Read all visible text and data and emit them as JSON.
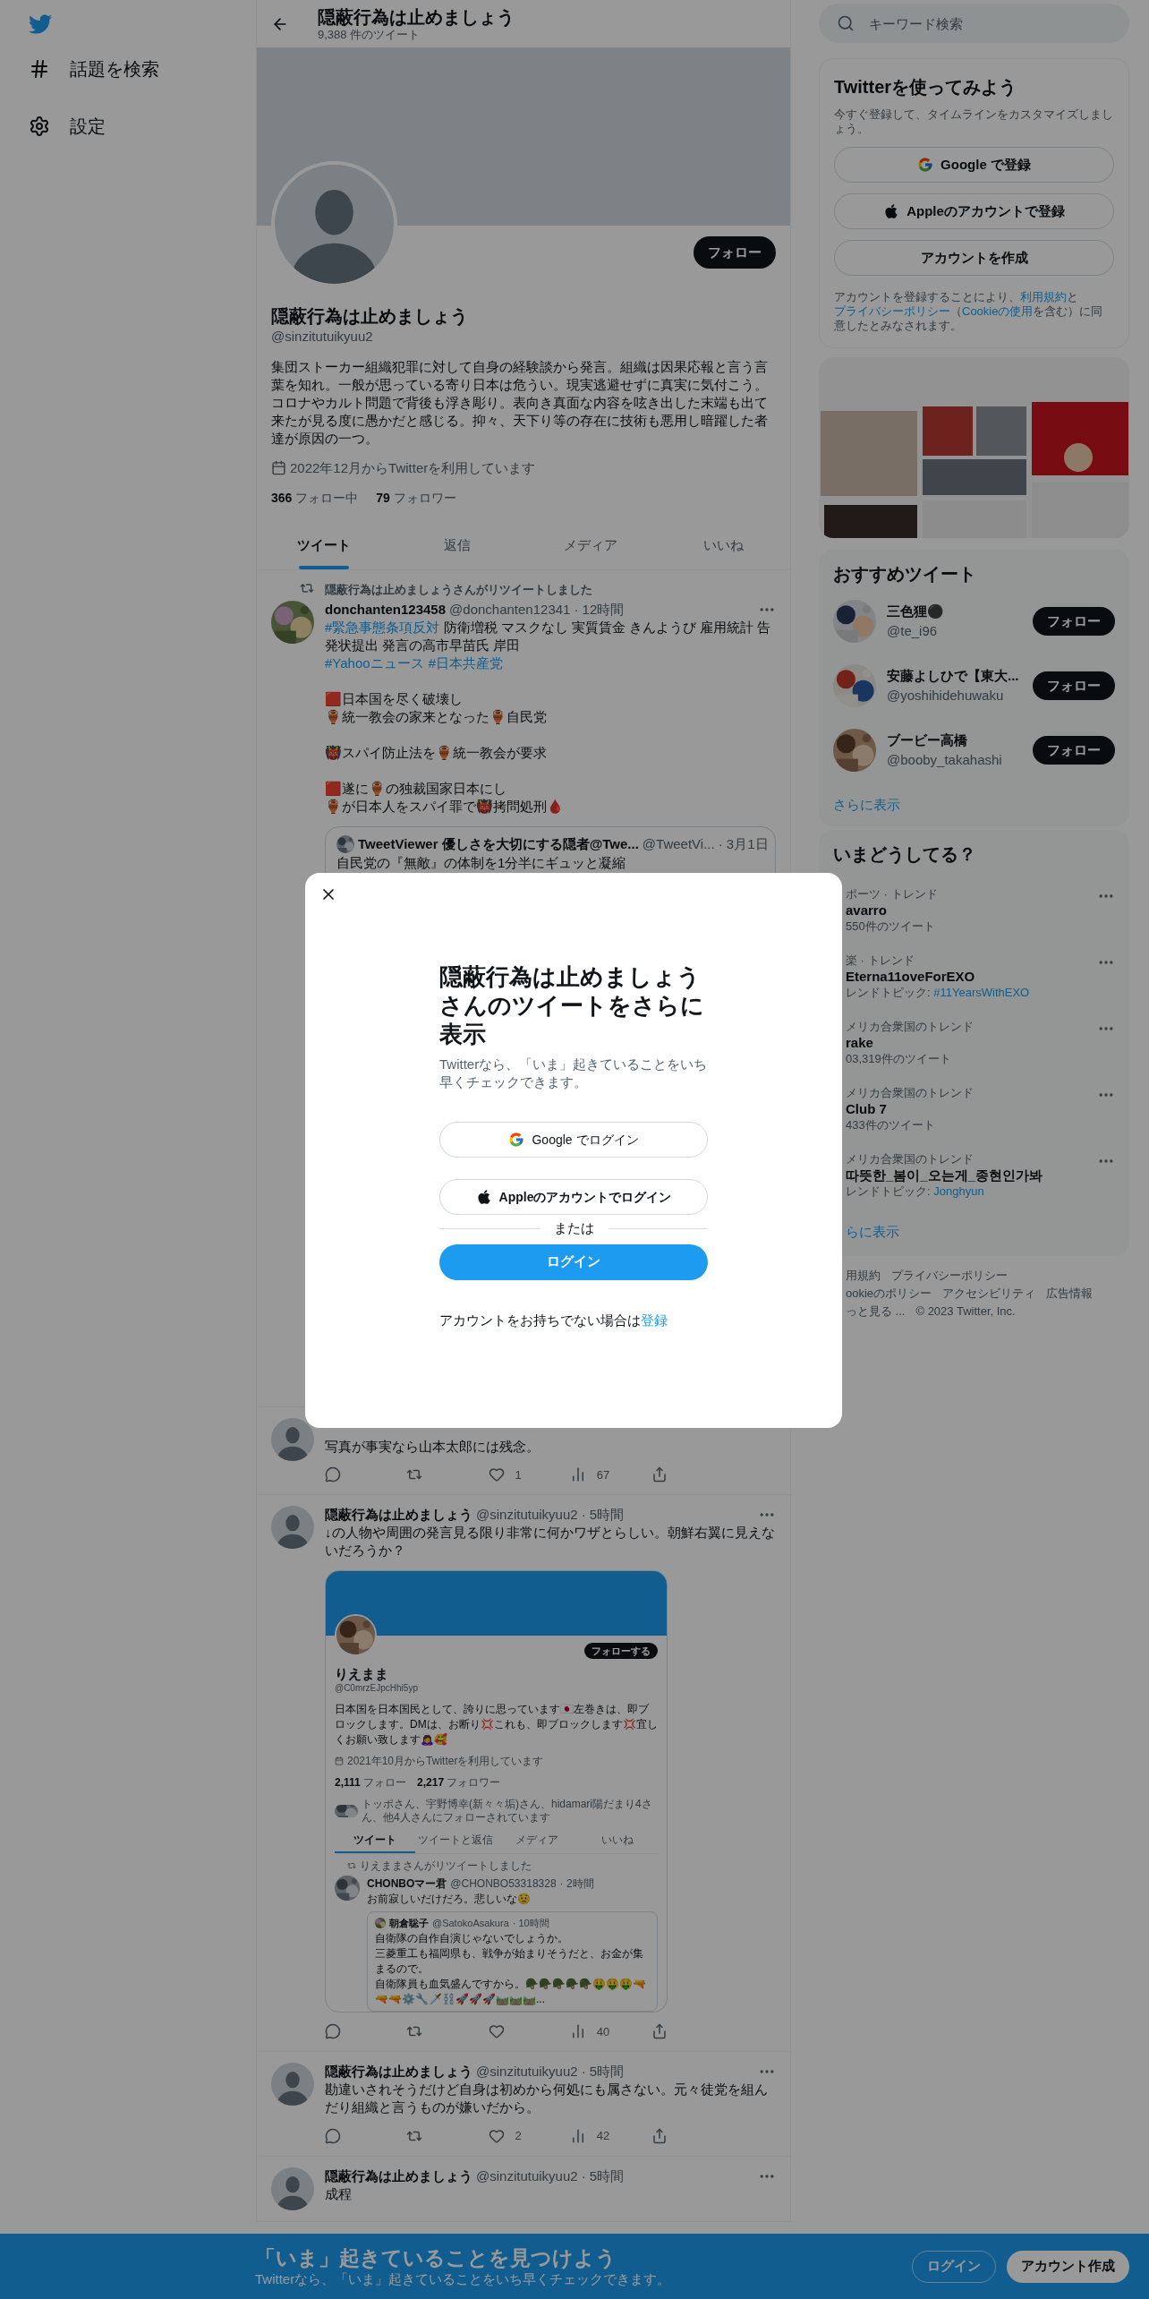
{
  "sidebar": {
    "items": [
      {
        "label": "話題を検索",
        "kind": "hashtag"
      },
      {
        "label": "設定",
        "kind": "settings"
      }
    ]
  },
  "header": {
    "title": "隠蔽行為は止めましょう",
    "subtitle": "9,388 件のツイート"
  },
  "profile": {
    "avatar": {
      "kind": "default"
    },
    "follow_button": "フォロー",
    "name": "隠蔽行為は止めましょう",
    "handle": "@sinzitutuikyuu2",
    "bio": "集団ストーカー組織犯罪に対して自身の経験談から発言。組織は因果応報と言う言葉を知れ。一般が思っている寄り日本は危うい。現実逃避せずに真実に気付こう。コロナやカルト問題で背後も浮き彫り。表向き真面な内容を呟き出した末端も出て来たが見る度に愚かだと感じる。抑々、天下り等の存在に技術も悪用し暗躍した者達が原因の一つ。",
    "joined": "2022年12月からTwitterを利用しています",
    "stats": [
      {
        "count": "366",
        "label": "フォロー中"
      },
      {
        "count": "79",
        "label": "フォロワー"
      }
    ]
  },
  "tabs": [
    {
      "label": "ツイート",
      "selected": true
    },
    {
      "label": "返信",
      "selected": false
    },
    {
      "label": "メディア",
      "selected": false
    },
    {
      "label": "いいね",
      "selected": false
    }
  ],
  "tweets": [
    {
      "retweet_note": "隠蔽行為は止めましょうさんがリツイートしました",
      "avatar": {
        "kind": "picture"
      },
      "name": "donchanten123458",
      "handle": "@donchanten12341",
      "time": "· 12時間",
      "paragraphs": [
        [
          [
            {
              "text": "#緊急事態条項反対",
              "kind": "tag"
            },
            {
              "text": " 防衛増税 マスクなし 実質賃金 きんようび 雇用統計 告発状提出 発言の高市早苗氏 岸田"
            }
          ],
          [
            {
              "text": "#Yahooニュース",
              "kind": "tag"
            },
            {
              "text": "#日本共産党",
              "kind": "tag"
            }
          ]
        ],
        [
          [
            {
              "text": "🟥日本国を尽く破壊し"
            }
          ],
          [
            {
              "text": "🏺統一教会の家来となった🏺自民党"
            }
          ]
        ],
        [
          [
            {
              "text": "👹スパイ防止法を🏺統一教会が要求"
            }
          ]
        ],
        [
          [
            {
              "text": "🟥遂に🏺の独裁国家日本にし"
            }
          ],
          [
            {
              "text": "🏺が日本人をスパイ罪で👹拷問処刑🩸"
            }
          ]
        ]
      ],
      "quote": {
        "avatar": {
          "kind": "picture"
        },
        "name": "TweetViewer 優しさを大切にする隠者@Twe...",
        "handle": "@TweetVi...",
        "time": "· 3月1日",
        "text": "自民党の『無敵』の体制を1分半にギュッと凝縮"
      }
    },
    {
      "avatar": {
        "kind": "default"
      },
      "paragraphs": [
        [
          [
            {
              "text": "写真が事実なら山本太郎には残念。"
            }
          ]
        ]
      ],
      "actions": [
        {
          "kind": "reply"
        },
        {
          "kind": "retweet"
        },
        {
          "kind": "like",
          "count": "1"
        },
        {
          "kind": "views",
          "count": "67"
        },
        {
          "kind": "share"
        }
      ]
    },
    {
      "avatar": {
        "kind": "default"
      },
      "name": "隠蔽行為は止めましょう",
      "handle": "@sinzitutuikyuu2",
      "time": "· 5時間",
      "paragraphs": [
        [
          [
            {
              "text": "↓の人物や周囲の発言見る限り非常に何かワザとらしい。朝鮮右翼に見えないだろうか？"
            }
          ]
        ]
      ],
      "embed": {
        "follow_button": "フォローする",
        "name": "りえまま",
        "handle": "@C0mrzEJpcHhi5yp",
        "bio": "日本国を日本国民として、誇りに思っています🇯🇵左巻きは、即ブロックします。DMは、お断り💢これも、即ブロックします💢宜しくお願い致します🙇‍♀️🥰",
        "joined": "2021年10月からTwitterを利用しています",
        "stats": [
          {
            "count": "2,111",
            "label": "フォロー"
          },
          {
            "count": "2,217",
            "label": "フォロワー"
          }
        ],
        "followed_by": "トッポさん、宇野博幸(新々々垢)さん、hidamari陽だまり4さん、他4人さんにフォローされています",
        "tabs": [
          {
            "label": "ツイート",
            "selected": true
          },
          {
            "label": "ツイートと返信",
            "selected": false
          },
          {
            "label": "メディア",
            "selected": false
          },
          {
            "label": "いいね",
            "selected": false
          }
        ],
        "retweet_note": "りえままさんがリツイートしました",
        "tweet": {
          "name": "CHONBOマー君",
          "handle": "@CHONBO53318328",
          "time": "· 2時間",
          "text": "お前寂しいだけだろ。悲しいな😟"
        },
        "quote": {
          "name": "朝倉聡子",
          "handle": "@SatokoAsakura",
          "time": "· 10時間",
          "lines": [
            "自衛隊の自作自演じゃないでしょうか。",
            "三菱重工も福岡県も、戦争が始まりそうだと、お金が集まるので。",
            "自衛隊員も血気盛んですから。🪖🪖🪖🪖🪖🤑🤑🤑🔫🔫🔫⚙️🔧🗡️⛓️🚀🚀🚀🛤️🛤️🛤️..."
          ]
        }
      },
      "actions": [
        {
          "kind": "reply"
        },
        {
          "kind": "retweet"
        },
        {
          "kind": "like"
        },
        {
          "kind": "views",
          "count": "40"
        },
        {
          "kind": "share"
        }
      ]
    },
    {
      "avatar": {
        "kind": "default"
      },
      "name": "隠蔽行為は止めましょう",
      "handle": "@sinzitutuikyuu2",
      "time": "· 5時間",
      "paragraphs": [
        [
          [
            {
              "text": "勘違いされそうだけど自身は初めから何処にも属さない。元々徒党を組んだり組織と言うものが嫌いだから。"
            }
          ]
        ]
      ],
      "actions": [
        {
          "kind": "reply"
        },
        {
          "kind": "retweet"
        },
        {
          "kind": "like",
          "count": "2"
        },
        {
          "kind": "views",
          "count": "42"
        },
        {
          "kind": "share"
        }
      ]
    },
    {
      "avatar": {
        "kind": "default"
      },
      "name": "隠蔽行為は止めましょう",
      "handle": "@sinzitutuikyuu2",
      "time": "· 5時間",
      "paragraphs": [
        [
          [
            {
              "text": "成程"
            }
          ]
        ]
      ]
    }
  ],
  "search": {
    "placeholder": "キーワード検索"
  },
  "signup": {
    "title": "Twitterを使ってみよう",
    "text": "今すぐ登録して、タイムラインをカスタマイズしましょう。",
    "buttons": [
      {
        "label": "Google で登録",
        "kind": "google"
      },
      {
        "label": "Appleのアカウントで登録",
        "kind": "apple"
      },
      {
        "label": "アカウントを作成",
        "kind": "plain"
      }
    ],
    "legal": [
      {
        "text": "アカウントを登録することにより、"
      },
      {
        "text": "利用規約",
        "kind": "link"
      },
      {
        "text": "と"
      },
      {
        "text": "プライバシーポリシー",
        "kind": "link"
      },
      {
        "text": "（"
      },
      {
        "text": "Cookieの使用",
        "kind": "link"
      },
      {
        "text": "を含む）に同意したとみなされます。"
      }
    ]
  },
  "media": {
    "kind": "picture"
  },
  "who_to_follow": {
    "title": "おすすめツイート",
    "users": [
      {
        "name": "三色狸⚫",
        "handle": "@te_i96",
        "button": "フォロー"
      },
      {
        "name": "安藤よしひで【東大...",
        "handle": "@yoshihidehuwaku",
        "button": "フォロー"
      },
      {
        "name": "ブービー高橋",
        "handle": "@booby_takahashi",
        "button": "フォロー"
      }
    ],
    "more": "さらに表示"
  },
  "trends": {
    "title": "いまどうしてる？",
    "items": [
      {
        "context": "ポーツ · トレンド",
        "name": "avarro",
        "meta": "550件のツイート"
      },
      {
        "context": "楽 · トレンド",
        "name": "Eterna11oveForEXO",
        "meta": "レンドトピック: ",
        "link": "#11YearsWithEXO"
      },
      {
        "context": "メリカ合衆国のトレンド",
        "name": "rake",
        "meta": "03,319件のツイート"
      },
      {
        "context": "メリカ合衆国のトレンド",
        "name": "Club 7",
        "meta": "433件のツイート"
      },
      {
        "context": "メリカ合衆国のトレンド",
        "name": "따뜻한_봄이_오는게_종현인가봐",
        "meta": "レンドトピック: ",
        "link": "Jonghyun"
      }
    ],
    "more": "らに表示"
  },
  "footer": {
    "links": [
      [
        "用規約",
        "プライバシーポリシー"
      ],
      [
        "ookieのポリシー",
        "アクセシビリティ",
        "広告情報"
      ],
      [
        "っと見る ..."
      ]
    ],
    "copyright": "© 2023 Twitter, Inc."
  },
  "modal": {
    "title": "隠蔽行為は止めましょうさんのツイートをさらに表示",
    "text": "Twitterなら、「いま」起きていることをいち早くチェックできます。",
    "buttons": [
      {
        "label": "Google でログイン",
        "kind": "google"
      },
      {
        "label": "Appleのアカウントでログイン",
        "kind": "apple"
      }
    ],
    "separator": "または",
    "login": "ログイン",
    "signup_prompt": "アカウントをお持ちでない場合は",
    "signup_link": "登録"
  },
  "bottom_bar": {
    "title": "「いま」起きていることを見つけよう",
    "text": "Twitterなら、「いま」起きていることをいち早くチェックできます。",
    "login": "ログイン",
    "signup": "アカウント作成"
  }
}
